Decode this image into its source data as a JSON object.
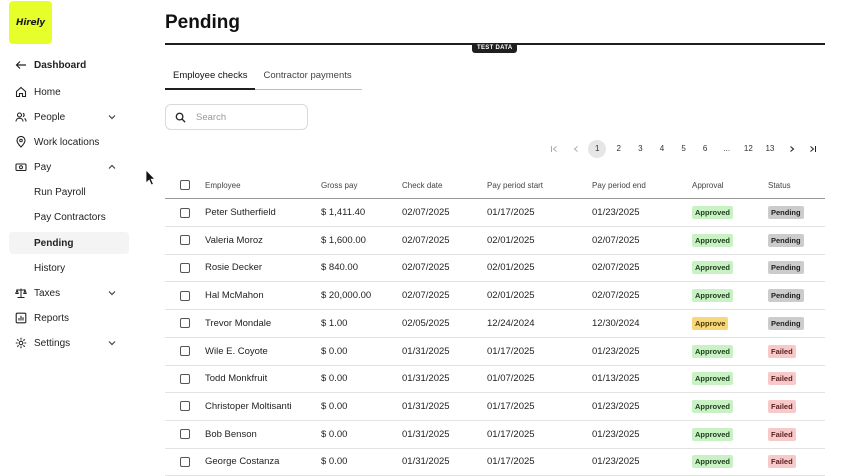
{
  "logo": {
    "text": "Hirely"
  },
  "sidebar": {
    "back_label": "Dashboard",
    "items": [
      {
        "label": "Home",
        "icon": "home-icon"
      },
      {
        "label": "People",
        "icon": "people-icon"
      },
      {
        "label": "Work locations",
        "icon": "location-pin-icon"
      },
      {
        "label": "Pay",
        "icon": "money-icon"
      },
      {
        "label": "Run Payroll"
      },
      {
        "label": "Pay Contractors"
      },
      {
        "label": "Pending"
      },
      {
        "label": "History"
      },
      {
        "label": "Taxes",
        "icon": "scale-icon"
      },
      {
        "label": "Reports",
        "icon": "chart-icon"
      },
      {
        "label": "Settings",
        "icon": "gear-icon"
      }
    ]
  },
  "page": {
    "title": "Pending",
    "test_badge": "TEST DATA"
  },
  "tabs": [
    "Employee checks",
    "Contractor payments"
  ],
  "search": {
    "placeholder": "Search"
  },
  "pagination": {
    "pages": [
      "1",
      "2",
      "3",
      "4",
      "5",
      "6",
      "...",
      "12",
      "13"
    ],
    "current": "1"
  },
  "table": {
    "headers": [
      "Employee",
      "Gross pay",
      "Check date",
      "Pay period start",
      "Pay period end",
      "Approval",
      "Status"
    ],
    "rows": [
      {
        "employee": "Peter Sutherfield",
        "gross": "$ 1,411.40",
        "check": "02/07/2025",
        "start": "01/17/2025",
        "end": "01/23/2025",
        "approval": "Approved",
        "status": "Pending"
      },
      {
        "employee": "Valeria Moroz",
        "gross": "$ 1,600.00",
        "check": "02/07/2025",
        "start": "02/01/2025",
        "end": "02/07/2025",
        "approval": "Approved",
        "status": "Pending"
      },
      {
        "employee": "Rosie Decker",
        "gross": "$ 840.00",
        "check": "02/07/2025",
        "start": "02/01/2025",
        "end": "02/07/2025",
        "approval": "Approved",
        "status": "Pending"
      },
      {
        "employee": "Hal McMahon",
        "gross": "$ 20,000.00",
        "check": "02/07/2025",
        "start": "02/01/2025",
        "end": "02/07/2025",
        "approval": "Approved",
        "status": "Pending"
      },
      {
        "employee": "Trevor Mondale",
        "gross": "$ 1.00",
        "check": "02/05/2025",
        "start": "12/24/2024",
        "end": "12/30/2024",
        "approval": "Approve",
        "status": "Pending"
      },
      {
        "employee": "Wile E. Coyote",
        "gross": "$ 0.00",
        "check": "01/31/2025",
        "start": "01/17/2025",
        "end": "01/23/2025",
        "approval": "Approved",
        "status": "Failed"
      },
      {
        "employee": "Todd Monkfruit",
        "gross": "$ 0.00",
        "check": "01/31/2025",
        "start": "01/07/2025",
        "end": "01/13/2025",
        "approval": "Approved",
        "status": "Failed"
      },
      {
        "employee": "Christoper Moltisanti",
        "gross": "$ 0.00",
        "check": "01/31/2025",
        "start": "01/17/2025",
        "end": "01/23/2025",
        "approval": "Approved",
        "status": "Failed"
      },
      {
        "employee": "Bob Benson",
        "gross": "$ 0.00",
        "check": "01/31/2025",
        "start": "01/17/2025",
        "end": "01/23/2025",
        "approval": "Approved",
        "status": "Failed"
      },
      {
        "employee": "George Costanza",
        "gross": "$ 0.00",
        "check": "01/31/2025",
        "start": "01/17/2025",
        "end": "01/23/2025",
        "approval": "Approved",
        "status": "Failed"
      }
    ]
  },
  "colors": {
    "logo_bg": "#e6ff2a",
    "approved": "#c9f2c4",
    "approve": "#f7d77a",
    "pending": "#cccccc",
    "failed": "#f7c9c9"
  }
}
